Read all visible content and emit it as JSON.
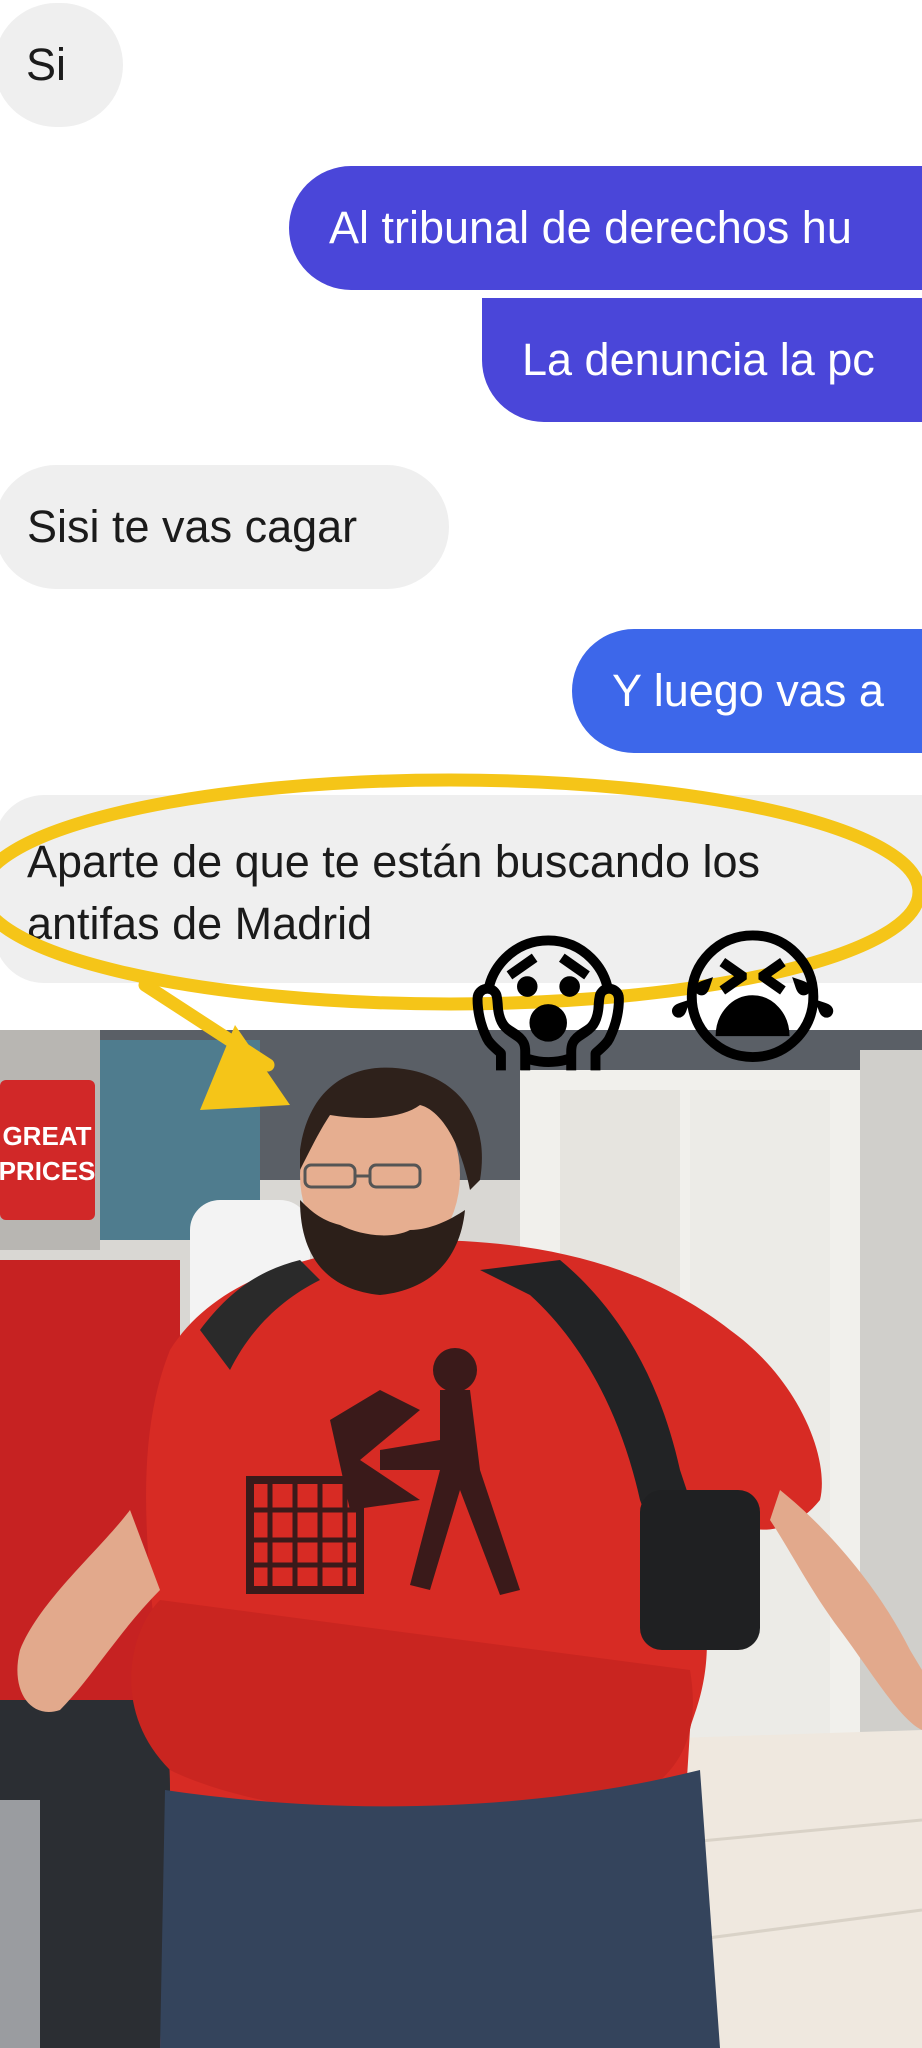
{
  "messages": [
    {
      "direction": "received",
      "text": "Si"
    },
    {
      "direction": "sent",
      "text": "Al tribunal de derechos hu"
    },
    {
      "direction": "sent",
      "text": "La denuncia la pc"
    },
    {
      "direction": "received",
      "text": "Sisi te vas cagar"
    },
    {
      "direction": "sent",
      "text": "Y luego vas a"
    },
    {
      "direction": "received",
      "lines": [
        "Aparte de que te están buscando los",
        "antifas de Madrid"
      ]
    }
  ],
  "overlay": {
    "highlight_color": "#f5c518",
    "emojis": [
      {
        "name": "face-screaming-in-fear",
        "glyph": "😱"
      },
      {
        "name": "loudly-crying-face",
        "glyph": "😭"
      }
    ]
  },
  "photo": {
    "sign_lines": [
      "GREAT",
      "PRICES"
    ]
  },
  "colors": {
    "sent_indigo": "#4a46d9",
    "sent_blue": "#3d67ea",
    "received_bg": "#efefef"
  }
}
